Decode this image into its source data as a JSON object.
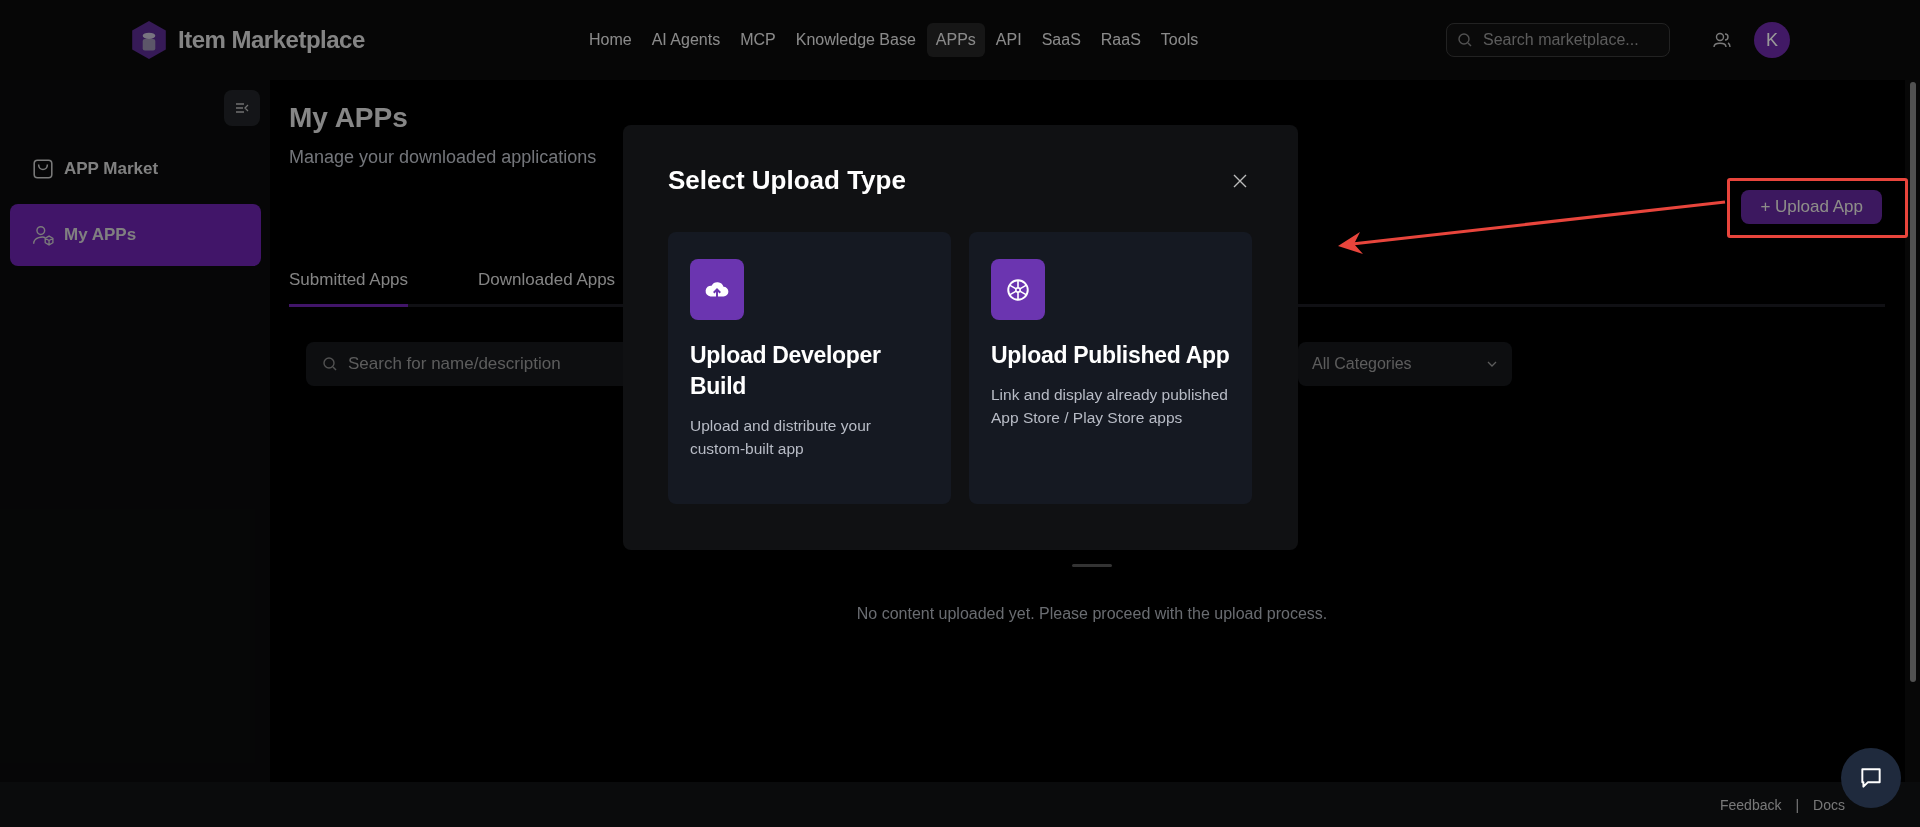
{
  "header": {
    "brand": "Item Marketplace",
    "nav": [
      {
        "label": "Home",
        "selected": false
      },
      {
        "label": "AI Agents",
        "selected": false
      },
      {
        "label": "MCP",
        "selected": false
      },
      {
        "label": "Knowledge Base",
        "selected": false
      },
      {
        "label": "APPs",
        "selected": true
      },
      {
        "label": "API",
        "selected": false
      },
      {
        "label": "SaaS",
        "selected": false
      },
      {
        "label": "RaaS",
        "selected": false
      },
      {
        "label": "Tools",
        "selected": false
      }
    ],
    "search": {
      "placeholder": "Search marketplace..."
    },
    "avatar": "K"
  },
  "sidebar": {
    "items": [
      {
        "kind": "market",
        "label": "APP Market",
        "selected": false
      },
      {
        "kind": "mine",
        "label": "My APPs",
        "selected": true
      }
    ]
  },
  "page": {
    "title": "My APPs",
    "subtitle": "Manage your downloaded applications",
    "upload_button": "+ Upload App",
    "tabs": [
      {
        "label": "Submitted Apps",
        "selected": true
      },
      {
        "label": "Downloaded Apps",
        "selected": false
      }
    ],
    "search": {
      "placeholder": "Search for name/description"
    },
    "category": {
      "value": "All Categories"
    },
    "empty_message": "No content uploaded yet. Please proceed with the upload process."
  },
  "modal": {
    "title": "Select Upload Type",
    "options": [
      {
        "kind": "build",
        "title": "Upload Developer Build",
        "description": "Upload and distribute your custom-built app"
      },
      {
        "kind": "published",
        "title": "Upload Published App",
        "description": "Link and display already published App Store / Play Store apps"
      }
    ]
  },
  "footer": {
    "links": [
      "Feedback",
      "Docs"
    ],
    "separator": "|"
  }
}
